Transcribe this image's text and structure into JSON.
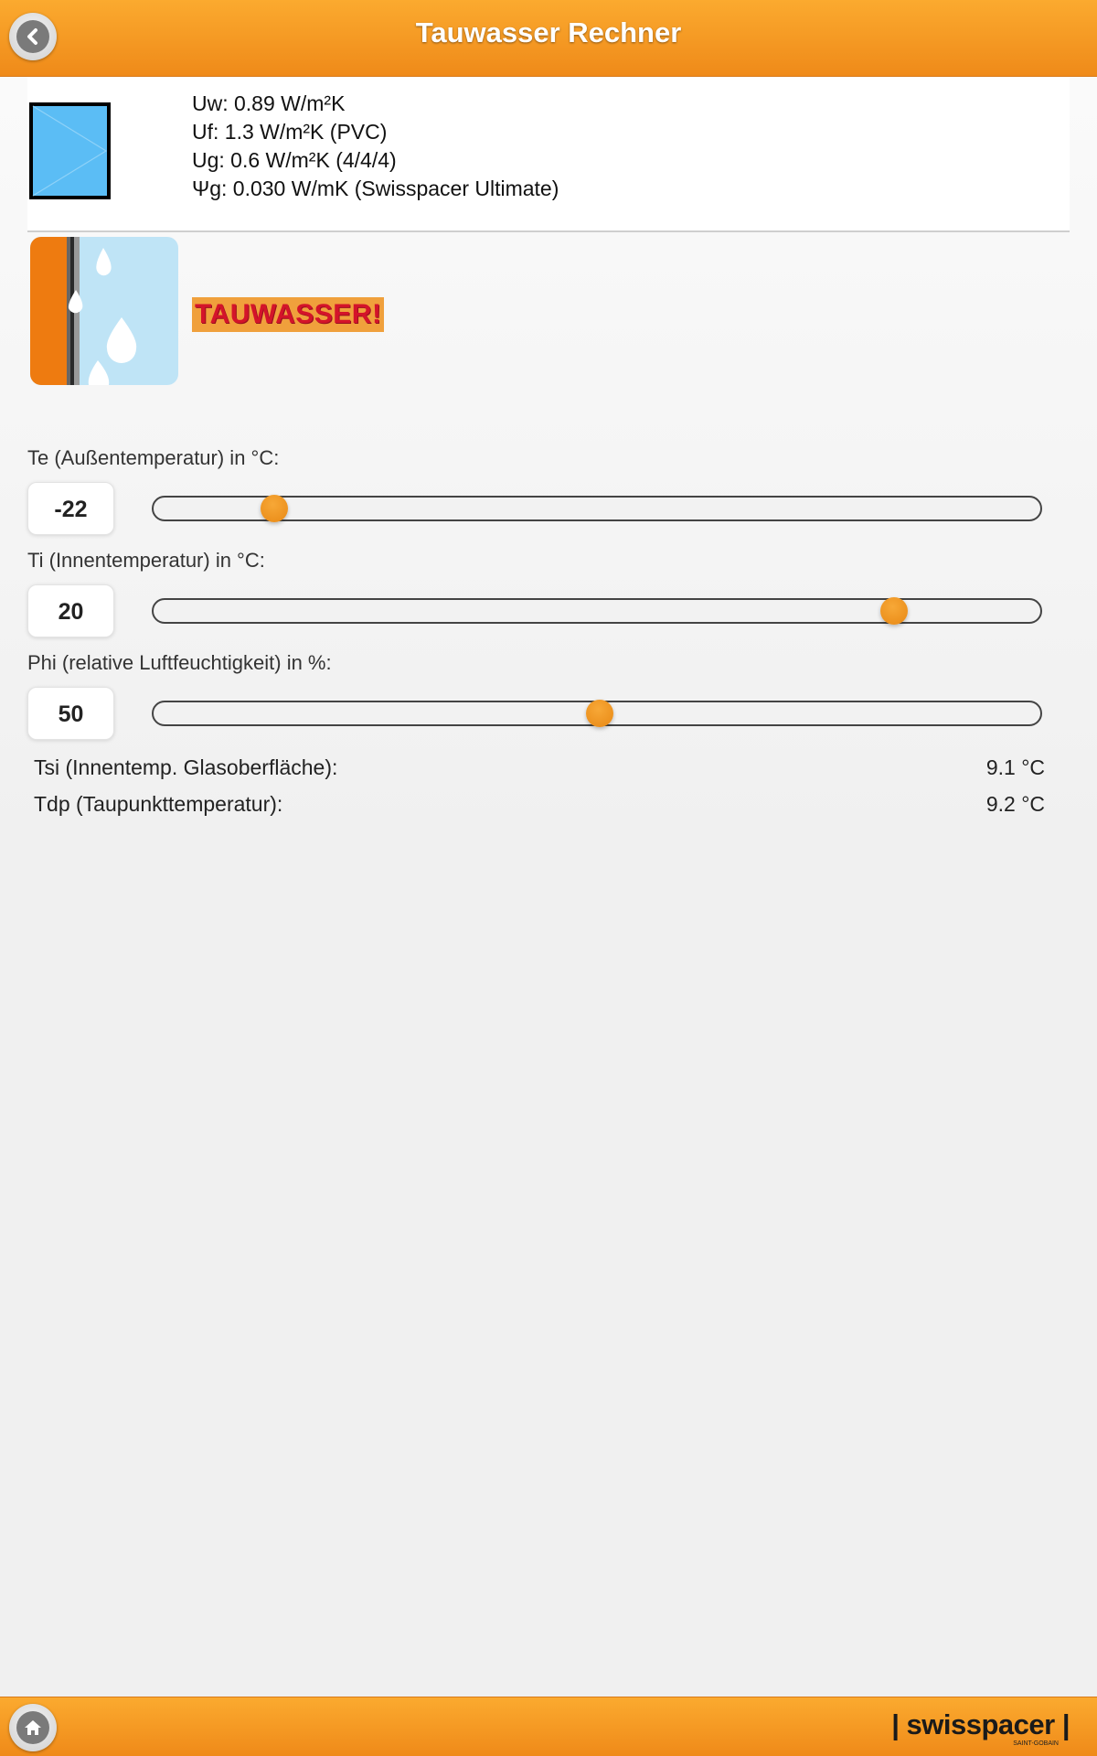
{
  "header": {
    "title": "Tauwasser Rechner",
    "back_icon": "chevron-left-icon"
  },
  "window_info": {
    "icon": "window-icon",
    "lines": [
      "Uw: 0.89 W/m²K",
      "Uf: 1.3 W/m²K (PVC)",
      "Ug: 0.6 W/m²K (4/4/4)",
      "Ψg: 0.030 W/mK (Swisspacer Ultimate)"
    ]
  },
  "status": {
    "icon": "condensation-icon",
    "label": "TAUWASSER!",
    "label_bg": "#f0a03c",
    "label_color": "#d4142a"
  },
  "sliders": [
    {
      "label": "Te (Außentemperatur) in °C:",
      "value": "-22",
      "fraction": 0.136
    },
    {
      "label": "Ti (Innentemperatur) in °C:",
      "value": "20",
      "fraction": 0.835
    },
    {
      "label": "Phi (relative Luftfeuchtigkeit) in %:",
      "value": "50",
      "fraction": 0.503
    }
  ],
  "results": [
    {
      "label": "Tsi (Innentemp. Glasoberfläche):",
      "value": "9.1  °C"
    },
    {
      "label": "Tdp (Taupunkttemperatur):",
      "value": "9.2  °C"
    }
  ],
  "footer": {
    "home_icon": "home-icon",
    "brand": "| swisspacer |",
    "brand_sub": "SAINT-GOBAIN"
  },
  "colors": {
    "accent": "#f39a22",
    "thumb": "#ee8d1a"
  }
}
